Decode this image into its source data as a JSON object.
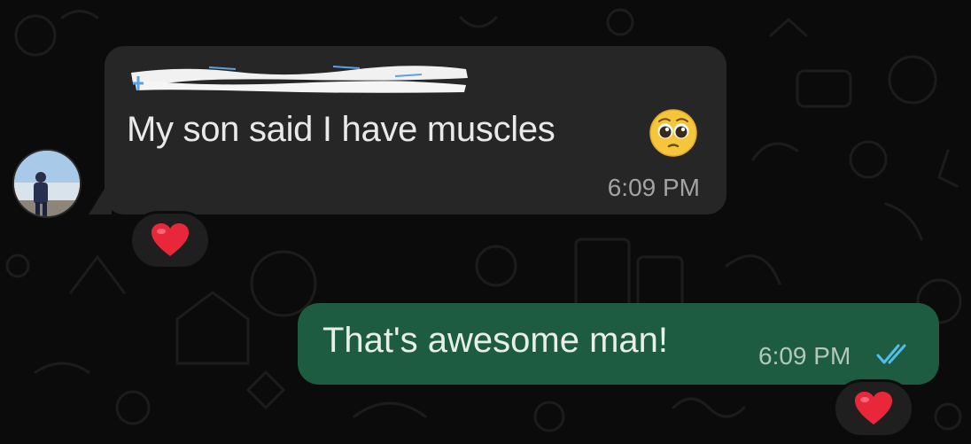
{
  "chat": {
    "incoming": {
      "sender_redacted": true,
      "text": "My son said I have muscles",
      "emoji": "pleading-face",
      "time": "6:09 PM",
      "reaction": "❤️"
    },
    "outgoing": {
      "text": "That's awesome man!",
      "time": "6:09 PM",
      "status": "read",
      "reaction": "❤️"
    }
  },
  "colors": {
    "background": "#0b0b0b",
    "incoming_bubble": "#262626",
    "outgoing_bubble": "#1d5c41",
    "read_ticks": "#53bdeb"
  }
}
